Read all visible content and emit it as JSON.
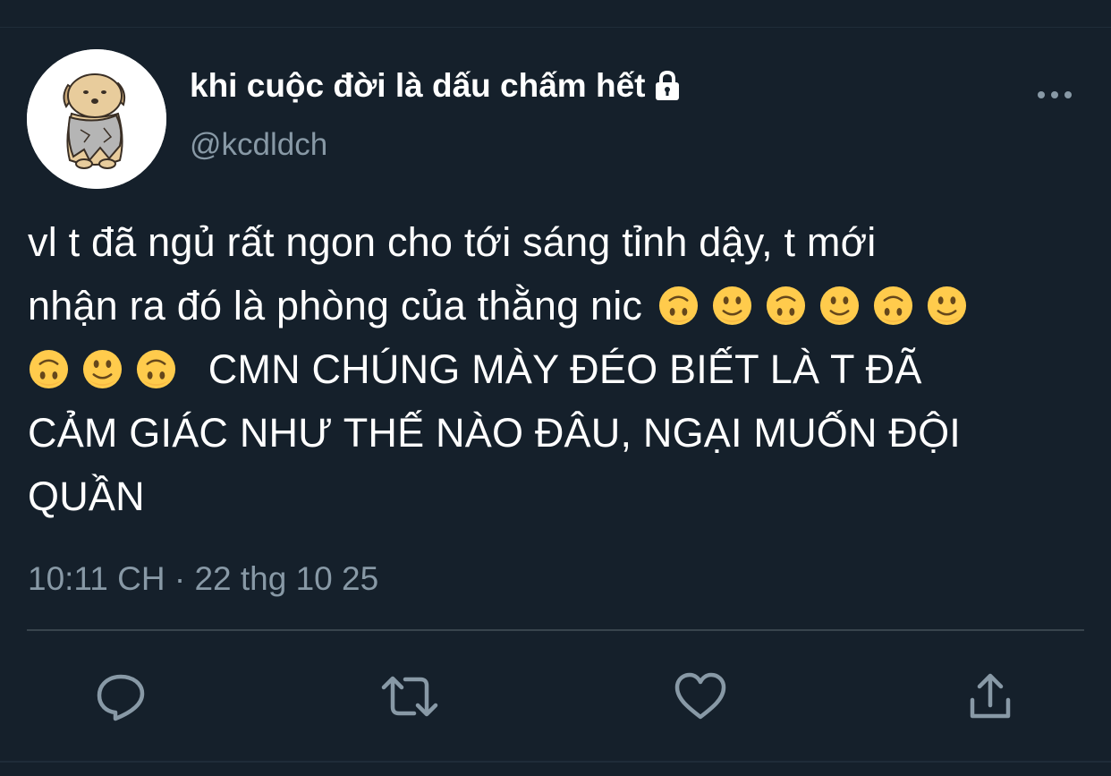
{
  "author": {
    "display_name": "khi cuộc đời là dấu chấm hết",
    "handle": "@kcdldch",
    "avatar_icon": "dog-avatar",
    "protected_icon": "lock-icon"
  },
  "tweet": {
    "line1": "vl t đã ngủ rất ngon cho tới sáng tỉnh dậy, t mới",
    "line2_text": "nhận ra đó là phòng của thằng nic",
    "line2_emojis": [
      "upside-down-face",
      "slightly-smiling-face",
      "upside-down-face",
      "slightly-smiling-face",
      "upside-down-face",
      "slightly-smiling-face"
    ],
    "line3_emojis": [
      "upside-down-face",
      "slightly-smiling-face",
      "upside-down-face"
    ],
    "line3_text": "CMN CHÚNG MÀY ĐÉO BIẾT LÀ T ĐÃ",
    "line4": "CẢM GIÁC NHƯ THẾ NÀO ĐÂU, NGẠI MUỐN ĐỘI",
    "line5": "QUẦN"
  },
  "timestamp": "10:11 CH · 22 thg 10 25",
  "actions": {
    "reply_icon": "reply-icon",
    "retweet_icon": "retweet-icon",
    "like_icon": "heart-icon",
    "share_icon": "share-icon"
  },
  "colors": {
    "background": "#15202b",
    "text_primary": "#ffffff",
    "text_secondary": "#8899a6",
    "divider": "#38444d",
    "emoji_yellow": "#ffcb4c"
  }
}
